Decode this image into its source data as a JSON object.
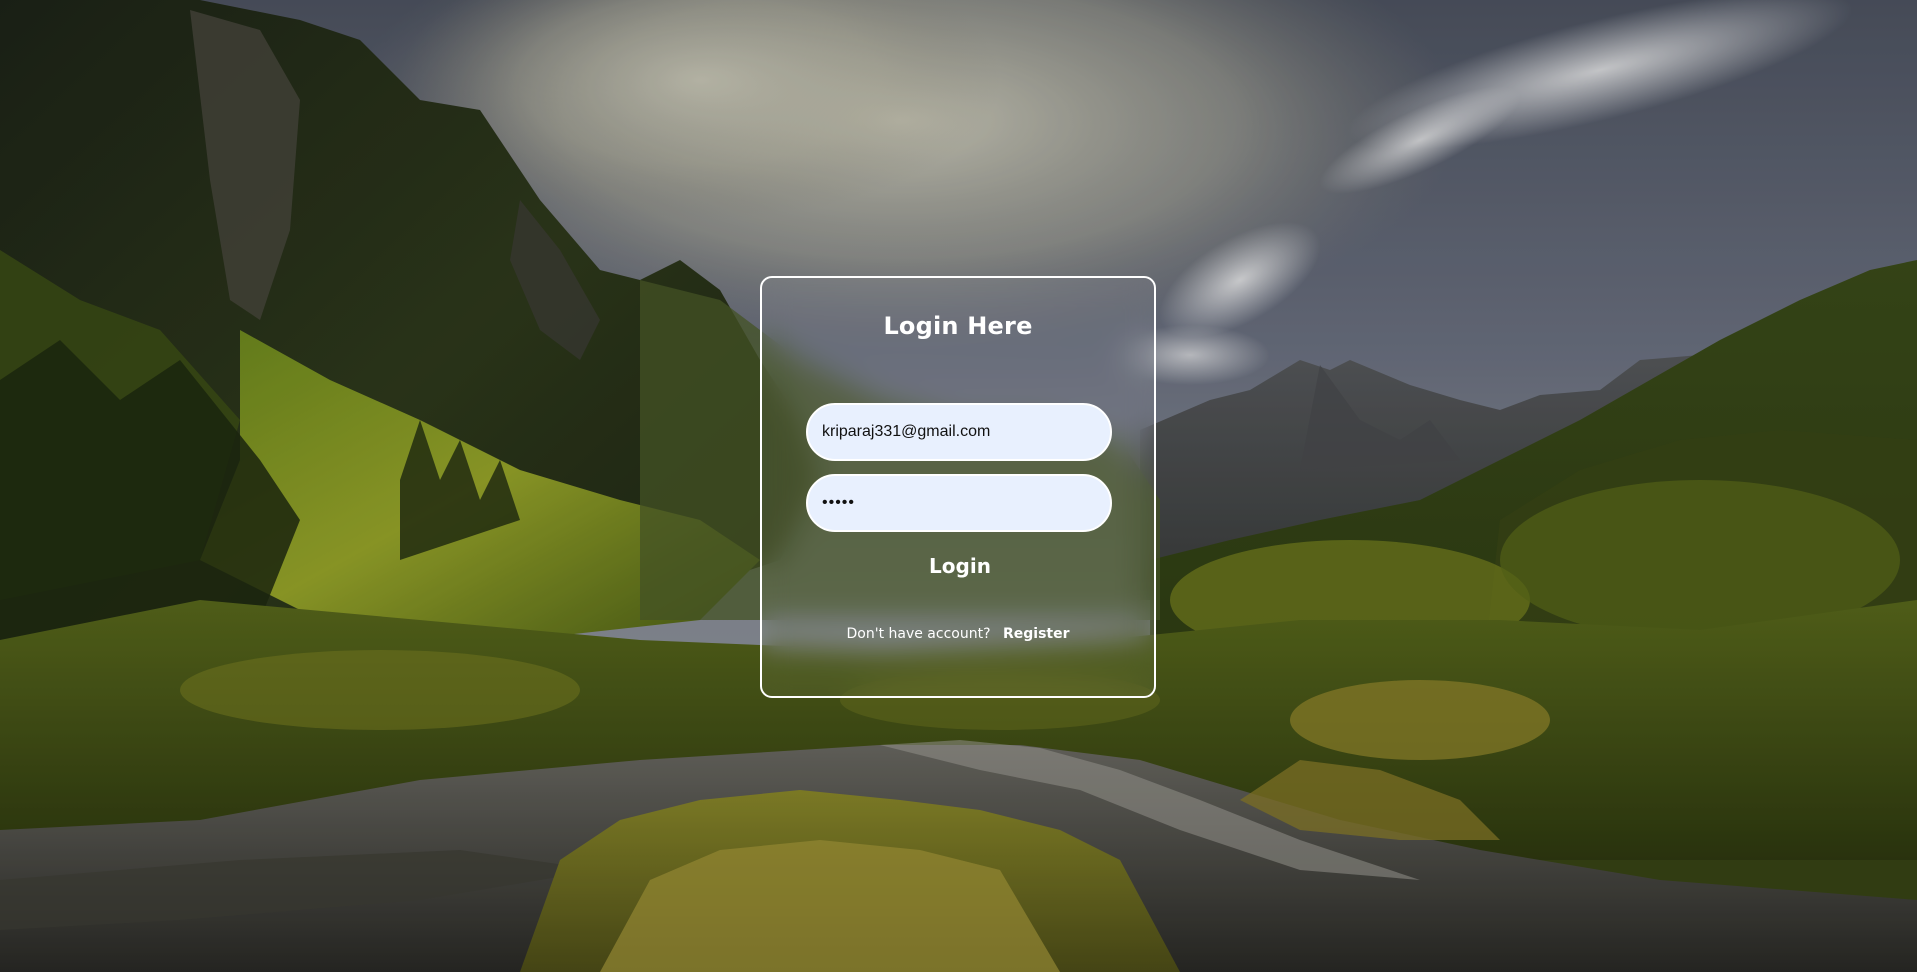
{
  "login": {
    "title": "Login Here",
    "email_value": "kriparaj331@gmail.com",
    "password_value": "12345",
    "submit_label": "Login",
    "no_account_text": "Don't have account?",
    "register_label": "Register"
  },
  "colors": {
    "input_bg": "#e8f0fe",
    "card_border": "#ffffff",
    "text": "#ffffff"
  },
  "icons": {
    "background": "mountain-valley-photo"
  }
}
